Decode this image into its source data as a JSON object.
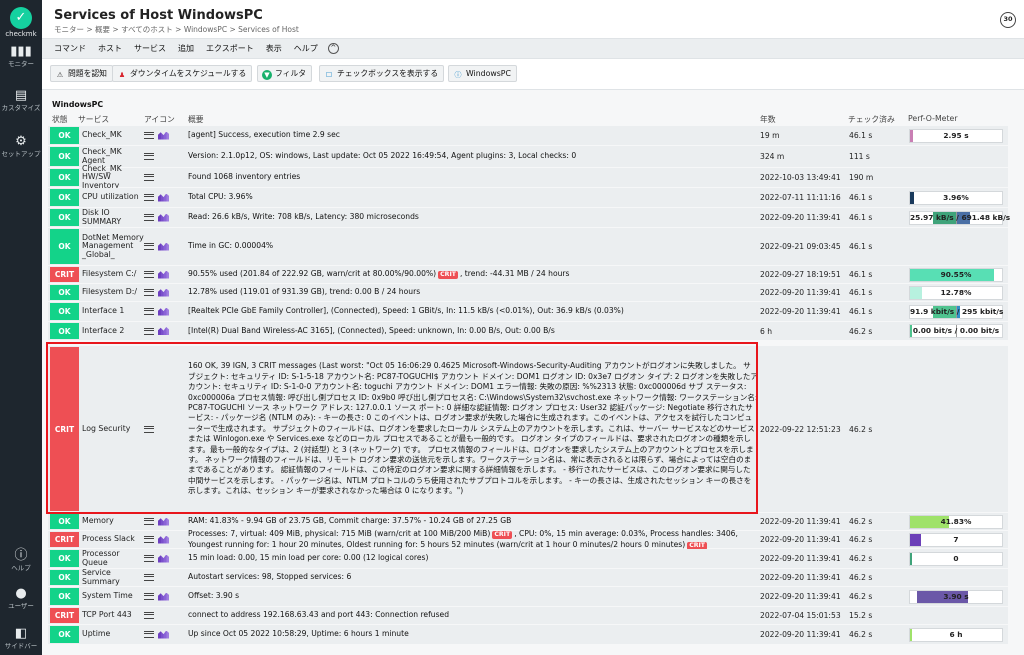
{
  "sidebar": {
    "logo_letter": "✓",
    "brand": "checkmk",
    "items": [
      {
        "label": "モニター",
        "icon": "bar-chart-icon"
      },
      {
        "label": "カスタマイズ",
        "icon": "customize-icon"
      },
      {
        "label": "セットアップ",
        "icon": "gear-icon"
      },
      {
        "label": "ヘルプ",
        "icon": "info-icon"
      },
      {
        "label": "ユーザー",
        "icon": "user-icon"
      },
      {
        "label": "サイドバー",
        "icon": "sidebar-icon"
      }
    ]
  },
  "header": {
    "title": "Services of Host WindowsPC",
    "breadcrumb": "モニター > 概要 > すべてのホスト > WindowsPC > Services of Host",
    "refresh_seconds": "30"
  },
  "menubar": {
    "items": [
      "コマンド",
      "ホスト",
      "サービス",
      "追加",
      "エクスポート",
      "表示",
      "ヘルプ"
    ],
    "toggle": "^"
  },
  "shortcuts": [
    {
      "label": "問題を認知",
      "icon": "⚠",
      "color": "#333"
    },
    {
      "label": "ダウンタイムをスケジュールする",
      "icon": "♟",
      "color": "#d8262e"
    },
    {
      "label": "フィルタ",
      "icon": "▼",
      "color": "#17b06b"
    },
    {
      "label": "チェックボックスを表示する",
      "icon": "☐",
      "color": "#1b87c8"
    },
    {
      "label": "WindowsPC",
      "icon": "ⓘ",
      "color": "#1b87c8"
    }
  ],
  "table": {
    "host": "WindowsPC",
    "columns": {
      "state": "状態",
      "service": "サービス",
      "icons": "アイコン",
      "summary": "概要",
      "age": "年数",
      "checked": "チェック済み",
      "perf": "Perf-O-Meter"
    },
    "rows": [
      {
        "state": "OK",
        "service": "Check_MK",
        "summary": "[agent] Success, execution time 2.9 sec",
        "age": "19 m",
        "checked": "46.1 s",
        "perf_text": "2.95 s",
        "perf_fill": 0.03,
        "perf_color": "#c97fb4"
      },
      {
        "state": "OK",
        "service": "Check_MK Agent",
        "summary": "Version: 2.1.0p12, OS: windows, Last update: Oct 05 2022 16:49:54, Agent plugins: 3, Local checks: 0",
        "age": "324 m",
        "checked": "111 s",
        "perf_text": ""
      },
      {
        "state": "OK",
        "service": "Check_MK HW/SW Inventory",
        "summary": "Found 1068 inventory entries",
        "age": "2022-10-03 13:49:41",
        "checked": "190 m",
        "perf_text": ""
      },
      {
        "state": "OK",
        "service": "CPU utilization",
        "summary": "Total CPU: 3.96%",
        "age": "2022-07-11 11:11:16",
        "checked": "46.1 s",
        "perf_text": "3.96%",
        "perf_fill": 0.04,
        "perf_color": "#1a3a5c"
      },
      {
        "state": "OK",
        "service": "Disk IO SUMMARY",
        "summary": "Read: 26.6 kB/s, Write: 708 kB/s, Latency: 380 microseconds",
        "age": "2022-09-20 11:39:41",
        "checked": "46.1 s",
        "perf_text": "25.97 kB/s / 691.48 kB/s",
        "perf_fill": 0.5,
        "perf_color": "#3fa37a",
        "perf_fill2": 0.3,
        "perf_color2": "#4a6fa5"
      },
      {
        "state": "OK",
        "service": "DotNet Memory Management _Global_",
        "summary": "Time in GC: 0.00004%",
        "age": "2022-09-21 09:03:45",
        "checked": "46.1 s",
        "perf_text": ""
      },
      {
        "state": "CRIT",
        "service": "Filesystem C:/",
        "summary_pre": "90.55% used (201.84 of 222.92 GB, warn/crit at 80.00%/90.00%)",
        "summary_badge": "CRIT",
        "summary_post": ", trend: -44.31 MB / 24 hours",
        "age": "2022-09-27 18:19:51",
        "checked": "46.1 s",
        "perf_text": "90.55%",
        "perf_fill": 0.91,
        "perf_color": "#58dfb4"
      },
      {
        "state": "OK",
        "service": "Filesystem D:/",
        "summary": "12.78% used (119.01 of 931.39 GB), trend: 0.00 B / 24 hours",
        "age": "2022-09-20 11:39:41",
        "checked": "46.1 s",
        "perf_text": "12.78%",
        "perf_fill": 0.13,
        "perf_color": "#b7f1df"
      },
      {
        "state": "OK",
        "service": "Interface 1",
        "summary": "[Realtek PCIe GbE Family Controller], (Connected), Speed: 1 GBit/s, In: 11.5 kB/s (<0.01%), Out: 36.9 kB/s (0.03%)",
        "age": "2022-09-20 11:39:41",
        "checked": "46.1 s",
        "perf_text": "91.9 kbit/s / 295 kbit/s",
        "perf_fill": 0.5,
        "perf_color": "#4fc38f",
        "perf_fill2": 0.08,
        "perf_color2": "#2f8fc8"
      },
      {
        "state": "OK",
        "service": "Interface 2",
        "summary": "[Intel(R) Dual Band Wireless-AC 3165], (Connected), Speed: unknown, In: 0.00 B/s, Out: 0.00 B/s",
        "age": "6 h",
        "checked": "46.2 s",
        "perf_text": "0.00 bit/s / 0.00 bit/s",
        "perf_fill": 0.0,
        "perf_color": "#4fc38f"
      },
      {
        "state": "CRIT",
        "service": "Log Security",
        "summary": "160 OK, 39 IGN, 3 CRIT messages (Last worst: \"Oct 05 16:06:29 0.4625 Microsoft-Windows-Security-Auditing アカウントがログオンに失敗しました。 サブジェクト: セキュリティ ID: S-1-5-18 アカウント名: PC87-TOGUCHI$ アカウント ドメイン: DOM1 ログオン ID: 0x3e7 ログオン タイプ: 2 ログオンを失敗したアカウント: セキュリティ ID: S-1-0-0 アカウント名: toguchi アカウント ドメイン: DOM1 エラー情報: 失敗の原因: %%2313 状態: 0xc000006d サブ ステータス: 0xc000006a プロセス情報: 呼び出し側プロセス ID: 0x9b0 呼び出し側プロセス名: C:\\Windows\\System32\\svchost.exe ネットワーク情報: ワークステーション名: PC87-TOGUCHI ソース ネットワーク アドレス: 127.0.0.1 ソース ポート: 0 詳細な認証情報: ログオン プロセス: User32 認証パッケージ: Negotiate 移行されたサービス: - パッケージ名 (NTLM のみ): - キーの長さ: 0 このイベントは、ログオン要求が失敗した場合に生成されます。このイベントは、アクセスを試行したコンピューターで生成されます。 サブジェクトのフィールドは、ログオンを要求したローカル システム上のアカウントを示します。これは、サーバー サービスなどのサービスまたは Winlogon.exe や Services.exe などのローカル プロセスであることが最も一般的です。 ログオン タイプのフィールドは、要求されたログオンの種類を示します。最も一般的なタイプは、2 (対話型) と 3 (ネットワーク) です。 プロセス情報のフィールドは、ログオンを要求したシステム上のアカウントとプロセスを示します。 ネットワーク情報のフィールドは、リモート ログオン要求の送信元を示します。ワークステーション名は、常に表示されるとは限らず、場合によっては空白のままであることがあります。 認証情報のフィールドは、この特定のログオン要求に関する詳細情報を示します。 - 移行されたサービスは、このログオン要求に関与した中間サービスを示します。 - パッケージ名は、NTLM プロトコルのうち使用されたサブプロトコルを示します。 - キーの長さは、生成されたセッション キーの長さを示します。これは、セッション キーが要求されなかった場合は 0 になります。\")",
        "age": "2022-09-22 12:51:23",
        "checked": "46.2 s",
        "perf_text": ""
      },
      {
        "state": "OK",
        "service": "Memory",
        "summary": "RAM: 41.83% - 9.94 GB of 23.75 GB, Commit charge: 37.57% - 10.24 GB of 27.25 GB",
        "age": "2022-09-20 11:39:41",
        "checked": "46.2 s",
        "perf_text": "41.83%",
        "perf_fill": 0.42,
        "perf_color": "#9fe26a"
      },
      {
        "state": "CRIT",
        "service": "Process Slack",
        "summary_pre": "Processes: 7, virtual: 409 MiB, physical: 715 MiB (warn/crit at 100 MiB/200 MiB)",
        "summary_badge": "CRIT",
        "summary_mid": ", CPU: 0%, 15 min average: 0.03%, Process handles: 3406, Youngest running for: 1 hour 20 minutes, Oldest running for: 5 hours 52 minutes (warn/crit at 1 hour 0 minutes/2 hours 0 minutes)",
        "summary_badge2": "CRIT",
        "age": "2022-09-20 11:39:41",
        "checked": "46.2 s",
        "perf_text": "7",
        "perf_fill": 0.12,
        "perf_color": "#6b3fb8"
      },
      {
        "state": "OK",
        "service": "Processor Queue",
        "summary": "15 min load: 0.00, 15 min load per core: 0.00 (12 logical cores)",
        "age": "2022-09-20 11:39:41",
        "checked": "46.2 s",
        "perf_text": "0",
        "perf_fill": 0.01,
        "perf_color": "#3fa37a"
      },
      {
        "state": "OK",
        "service": "Service Summary",
        "summary": "Autostart services: 98, Stopped services: 6",
        "age": "2022-09-20 11:39:41",
        "checked": "46.2 s",
        "perf_text": ""
      },
      {
        "state": "OK",
        "service": "System Time",
        "summary": "Offset: 3.90 s",
        "age": "2022-09-20 11:39:41",
        "checked": "46.2 s",
        "perf_text": "3.90 s",
        "perf_fill": 0.55,
        "perf_color": "#6b58a8",
        "perf_offset": 0.08
      },
      {
        "state": "CRIT",
        "service": "TCP Port 443",
        "summary": "connect to address 192.168.63.43 and port 443: Connection refused",
        "age": "2022-07-04 15:01:53",
        "checked": "15.2 s",
        "perf_text": ""
      },
      {
        "state": "OK",
        "service": "Uptime",
        "summary": "Up since Oct 05 2022 10:58:29, Uptime: 6 hours 1 minute",
        "age": "2022-09-20 11:39:41",
        "checked": "46.2 s",
        "perf_text": "6 h",
        "perf_fill": 0.02,
        "perf_color": "#9fe26a"
      }
    ]
  }
}
